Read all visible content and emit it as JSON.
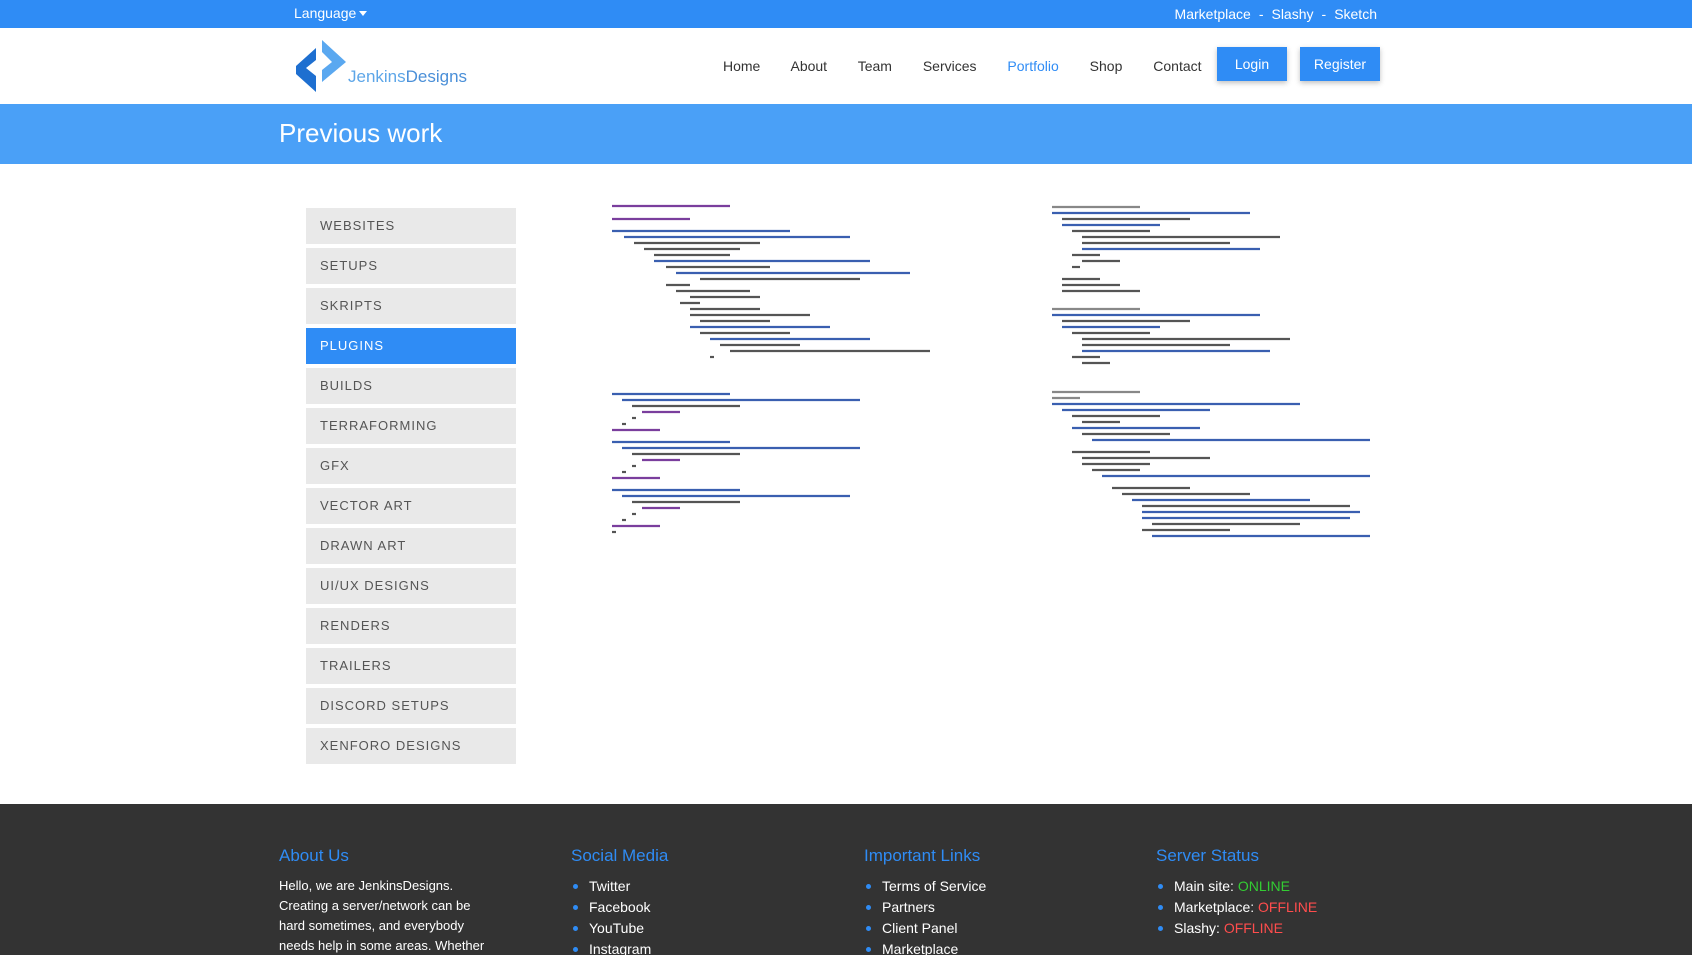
{
  "topbar": {
    "language_label": "Language",
    "links": [
      "Marketplace",
      "Slashy",
      "Sketch"
    ],
    "separator": "-"
  },
  "header": {
    "logo_text_a": "Jenkins",
    "logo_text_b": "Designs",
    "nav": [
      "Home",
      "About",
      "Team",
      "Services",
      "Portfolio",
      "Shop",
      "Contact"
    ],
    "active_nav": "Portfolio",
    "login_label": "Login",
    "register_label": "Register"
  },
  "banner": {
    "title": "Previous work"
  },
  "portfolio": {
    "categories": [
      "WEBSITES",
      "SETUPS",
      "SKRIPTS",
      "PLUGINS",
      "BUILDS",
      "TERRAFORMING",
      "GFX",
      "VECTOR ART",
      "DRAWN ART",
      "UI/UX DESIGNS",
      "RENDERS",
      "TRAILERS",
      "DISCORD SETUPS",
      "XENFORO DESIGNS"
    ],
    "active_category": "PLUGINS"
  },
  "footer": {
    "about": {
      "heading": "About Us",
      "text": "Hello, we are JenkinsDesigns. Creating a server/network can be hard sometimes, and everybody needs help in some areas. Whether"
    },
    "social": {
      "heading": "Social Media",
      "items": [
        "Twitter",
        "Facebook",
        "YouTube",
        "Instagram"
      ]
    },
    "links": {
      "heading": "Important Links",
      "items": [
        "Terms of Service",
        "Partners",
        "Client Panel",
        "Marketplace"
      ]
    },
    "status": {
      "heading": "Server Status",
      "items": [
        {
          "label": "Main site:",
          "state": "ONLINE"
        },
        {
          "label": "Marketplace:",
          "state": "OFFLINE"
        },
        {
          "label": "Slashy:",
          "state": "OFFLINE"
        }
      ],
      "colors": {
        "online": "#33cc33",
        "offline": "#ff4d4d"
      }
    }
  },
  "colors": {
    "accent": "#2f8cf5",
    "banner": "#4aa0f7",
    "footer_bg": "#333333"
  }
}
